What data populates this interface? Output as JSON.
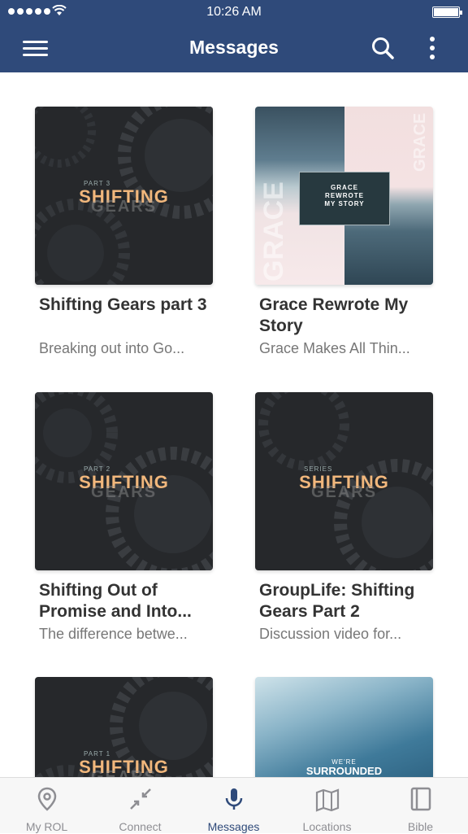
{
  "status_bar": {
    "time": "10:26 AM"
  },
  "nav": {
    "title": "Messages"
  },
  "cards": [
    {
      "title": "Shifting Gears part 3",
      "subtitle": "Breaking out into Go...",
      "art_series": "PART 3",
      "art_main": "SHIFTING",
      "art_ghost": "GEARS"
    },
    {
      "title": "Grace Rewrote My Story",
      "subtitle": "Grace Makes All Thin...",
      "art_line1": "GRACE",
      "art_line2": "REWROTE",
      "art_line3": "MY STORY",
      "art_vertical": "GRACE"
    },
    {
      "title": "Shifting Out of Promise and Into...",
      "subtitle": "The difference betwe...",
      "art_series": "PART 2",
      "art_main": "SHIFTING",
      "art_ghost": "GEARS"
    },
    {
      "title": "GroupLife: Shifting Gears Part 2",
      "subtitle": "Discussion video for...",
      "art_series": "SERIES",
      "art_main": "SHIFTING",
      "art_ghost": "GEARS"
    },
    {
      "title": "",
      "subtitle": "",
      "art_series": "PART 1",
      "art_main": "SHIFTING",
      "art_ghost": "GEARS"
    },
    {
      "title": "",
      "subtitle": "",
      "art_small": "WE'RE",
      "art_main": "SURROUNDED"
    }
  ],
  "tabs": [
    {
      "label": "My ROL",
      "icon": "location-pin-icon"
    },
    {
      "label": "Connect",
      "icon": "arrows-in-icon"
    },
    {
      "label": "Messages",
      "icon": "microphone-icon"
    },
    {
      "label": "Locations",
      "icon": "map-icon"
    },
    {
      "label": "Bible",
      "icon": "book-icon"
    }
  ],
  "colors": {
    "nav_bg": "#2f4a7a",
    "active_tab": "#2f4a7a",
    "inactive_tab": "#8e8e93"
  }
}
